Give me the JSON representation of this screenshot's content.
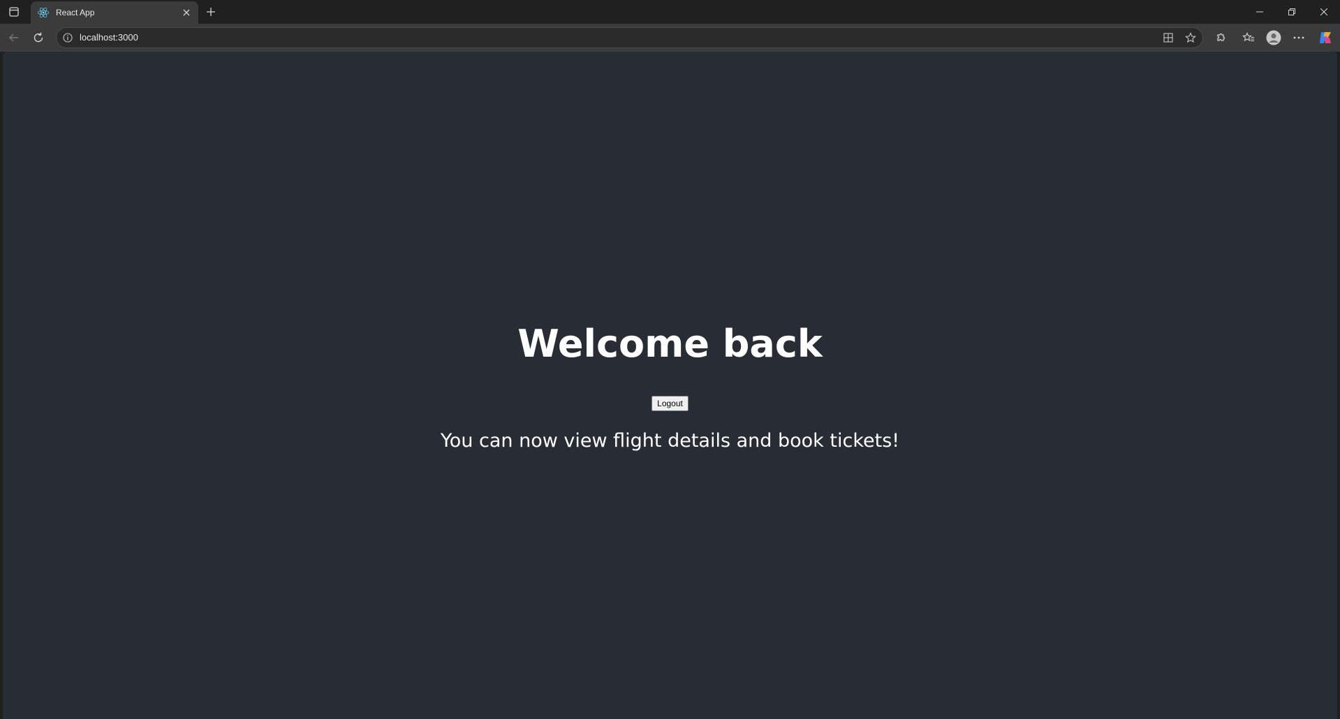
{
  "browser": {
    "tab": {
      "title": "React App",
      "favicon": "react-logo-icon"
    },
    "new_tab_icon": "plus-icon",
    "window_controls": [
      "minimize-icon",
      "restore-icon",
      "close-icon"
    ],
    "address": {
      "url": "localhost:3000",
      "site_info_icon": "info-icon"
    },
    "toolbar_icons": [
      "back-arrow-icon",
      "refresh-icon",
      "split-screen-icon",
      "favorite-star-icon",
      "extensions-icon",
      "favorites-icon",
      "profile-icon",
      "more-icon",
      "copilot-icon"
    ]
  },
  "page": {
    "heading": "Welcome back",
    "logout_label": "Logout",
    "message": "You can now view flight details and book tickets!"
  },
  "colors": {
    "page_background": "#282c34",
    "chrome_dark": "#202020",
    "chrome_toolbar": "#3b3b3b",
    "text": "#ffffff"
  }
}
